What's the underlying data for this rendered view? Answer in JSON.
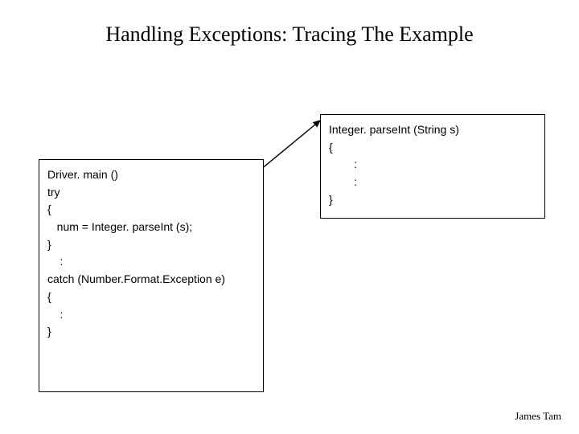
{
  "title": "Handling Exceptions: Tracing The Example",
  "left_box": {
    "text": "Driver. main ()\ntry\n{\n   num = Integer. parseInt (s);\n}\n    :\ncatch (Number.Format.Exception e)\n{\n    :\n}"
  },
  "right_box": {
    "text": "Integer. parseInt (String s)\n{\n        :\n        :\n}"
  },
  "footer": "James Tam"
}
